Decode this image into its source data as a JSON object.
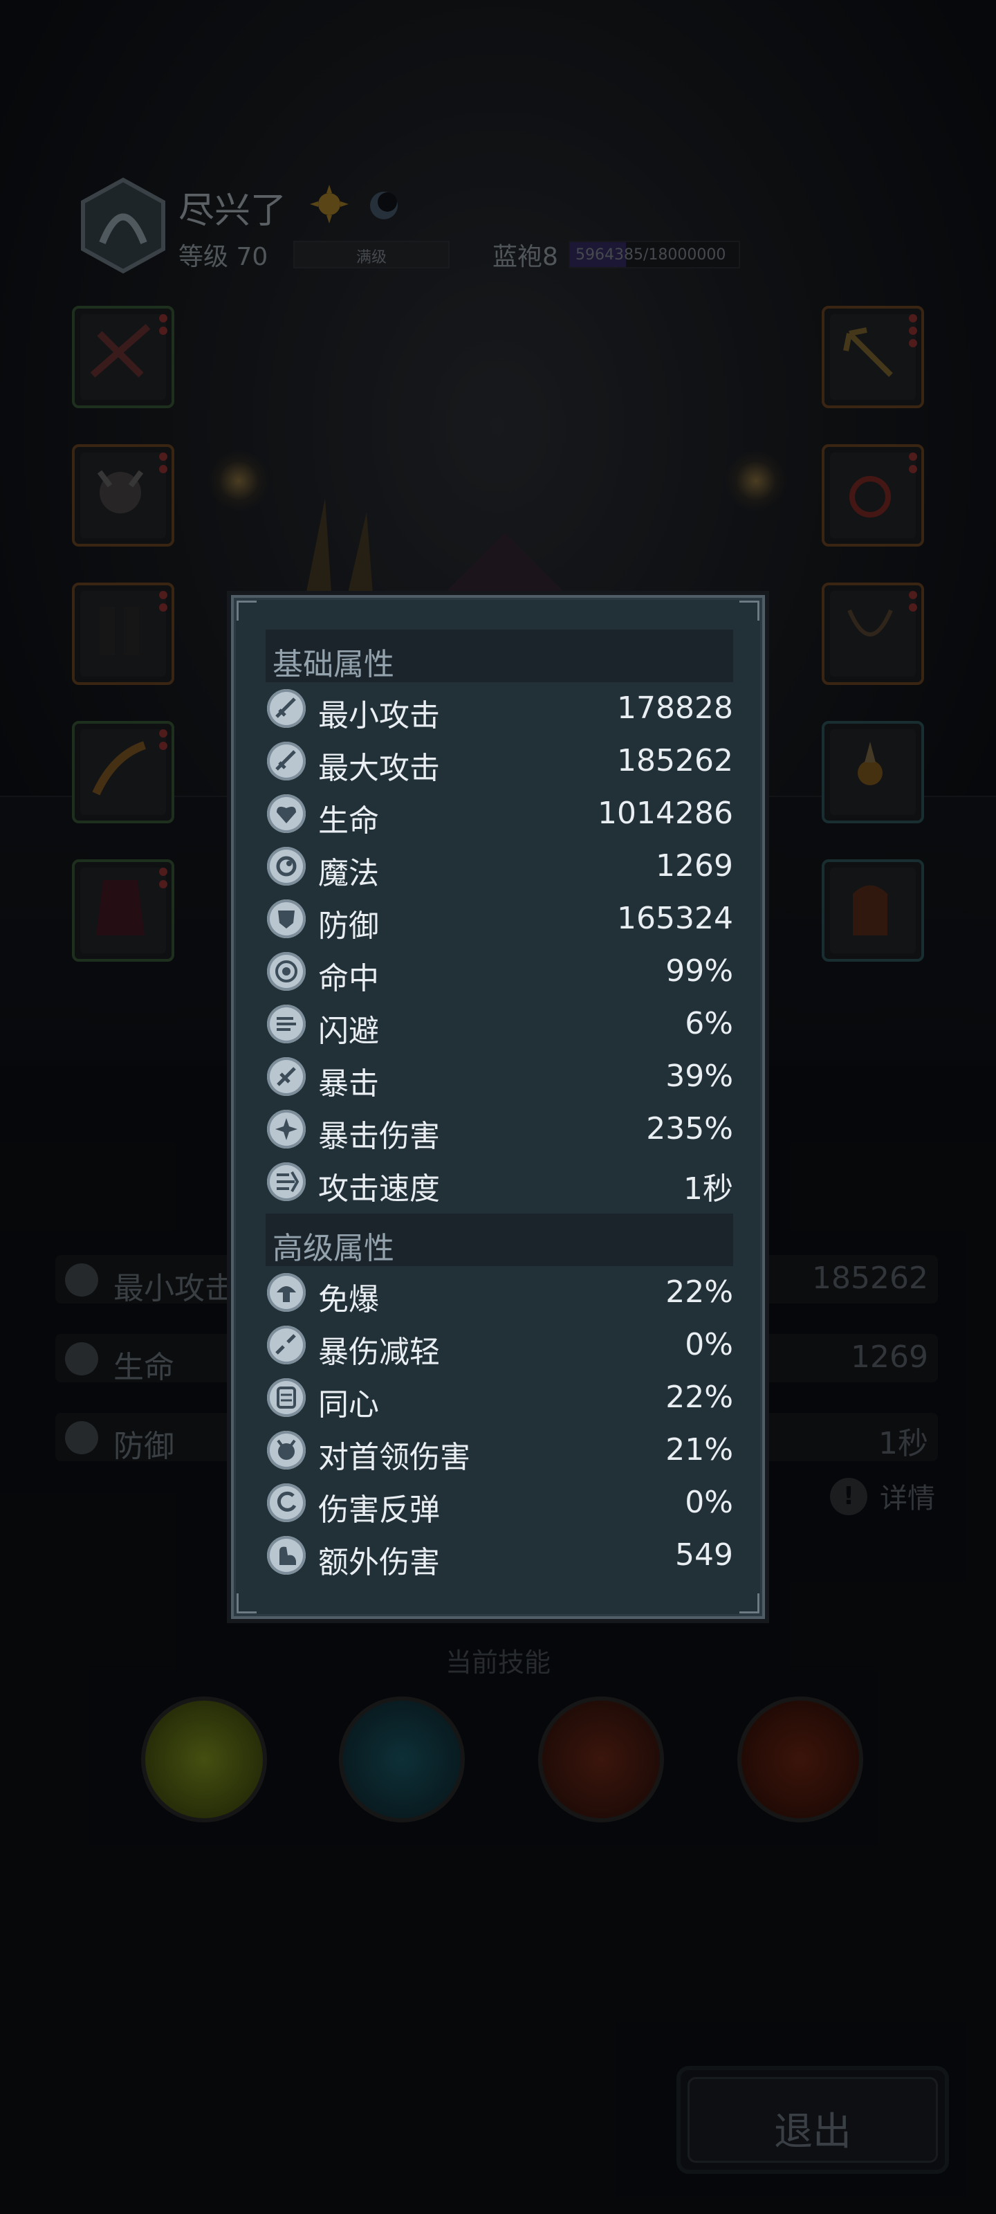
{
  "player": {
    "name": "尽兴了",
    "level_label": "等级 70",
    "level_bar_text": "满级",
    "rank_label": "蓝袍8",
    "xp_text": "5964385/18000000",
    "xp_progress": 0.331
  },
  "background_stats": {
    "left": [
      {
        "icon": "sword-icon",
        "label": "最小攻击"
      },
      {
        "icon": "heart-icon",
        "label": "生命"
      },
      {
        "icon": "shield-icon",
        "label": "防御"
      }
    ],
    "right_values": [
      "185262",
      "1269",
      "1秒"
    ],
    "detail_label": "详情"
  },
  "skills": {
    "title": "当前技能",
    "items": [
      {
        "icon": "bubbles-skill-icon",
        "color": "#5d6b16"
      },
      {
        "icon": "water-shield-skill-icon",
        "color": "#0f3a44"
      },
      {
        "icon": "fire-shield-skill-icon",
        "color": "#4a1a12"
      },
      {
        "icon": "crossed-axes-skill-icon",
        "color": "#4e1a10"
      }
    ]
  },
  "exit_label": "退出",
  "attributes": {
    "basic_title": "基础属性",
    "basic": [
      {
        "icon": "sword-icon",
        "label": "最小攻击",
        "value": "178828"
      },
      {
        "icon": "sword-icon",
        "label": "最大攻击",
        "value": "185262"
      },
      {
        "icon": "heart-icon",
        "label": "生命",
        "value": "1014286"
      },
      {
        "icon": "magic-orb-icon",
        "label": "魔法",
        "value": "1269"
      },
      {
        "icon": "shield-icon",
        "label": "防御",
        "value": "165324"
      },
      {
        "icon": "target-icon",
        "label": "命中",
        "value": "99%"
      },
      {
        "icon": "wind-icon",
        "label": "闪避",
        "value": "6%"
      },
      {
        "icon": "crit-icon",
        "label": "暴击",
        "value": "39%"
      },
      {
        "icon": "burst-icon",
        "label": "暴击伤害",
        "value": "235%"
      },
      {
        "icon": "speed-icon",
        "label": "攻击速度",
        "value": "1秒"
      }
    ],
    "advanced_title": "高级属性",
    "advanced": [
      {
        "icon": "mushroom-icon",
        "label": "免爆",
        "value": "22%"
      },
      {
        "icon": "broken-sword-icon",
        "label": "暴伤减轻",
        "value": "0%"
      },
      {
        "icon": "scroll-icon",
        "label": "同心",
        "value": "22%"
      },
      {
        "icon": "demon-icon",
        "label": "对首领伤害",
        "value": "21%"
      },
      {
        "icon": "reflect-icon",
        "label": "伤害反弹",
        "value": "0%"
      },
      {
        "icon": "arm-icon",
        "label": "额外伤害",
        "value": "549"
      }
    ]
  }
}
